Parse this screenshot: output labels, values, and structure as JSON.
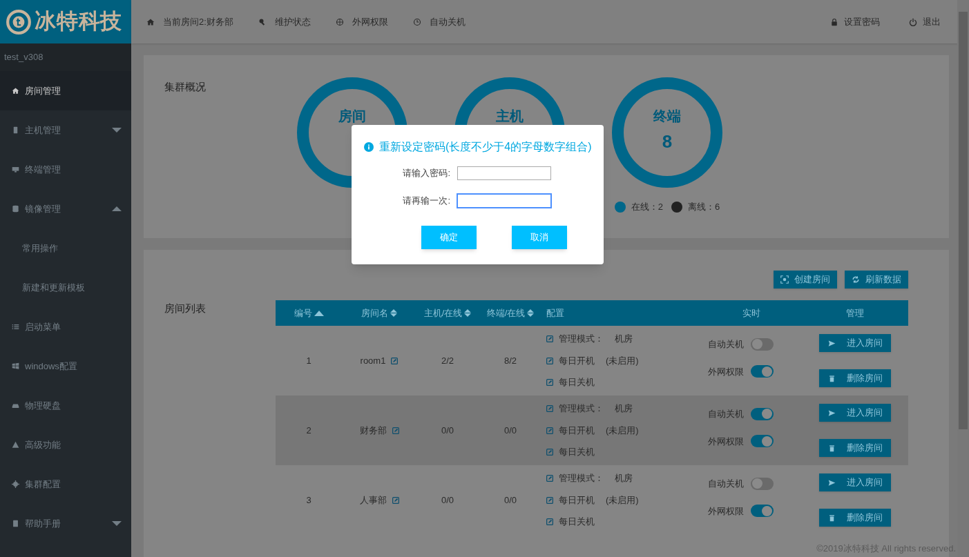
{
  "logo": {
    "text": "冰特科技"
  },
  "topnav": [
    {
      "label": "当前房间2:财务部"
    },
    {
      "label": "维护状态"
    },
    {
      "label": "外网权限"
    },
    {
      "label": "自动关机"
    }
  ],
  "topnav_right": [
    {
      "label": "设置密码"
    },
    {
      "label": "退出"
    }
  ],
  "version": "test_v308",
  "sidebar": {
    "items": [
      {
        "label": "房间管理",
        "selected": true
      },
      {
        "label": "主机管理",
        "selected": false,
        "expanded": false
      },
      {
        "label": "终端管理",
        "selected": false
      },
      {
        "label": "镜像管理",
        "selected": false,
        "expanded": true,
        "children": [
          {
            "label": "常用操作",
            "selected": false
          },
          {
            "label": "新建和更新模板",
            "selected": false
          }
        ]
      },
      {
        "label": "启动菜单",
        "selected": false
      },
      {
        "label": "windows配置",
        "selected": false
      },
      {
        "label": "物理硬盘",
        "selected": false
      },
      {
        "label": "高级功能",
        "selected": false
      },
      {
        "label": "集群配置",
        "selected": false
      },
      {
        "label": "帮助手册",
        "selected": false,
        "expanded": false
      }
    ]
  },
  "overview": {
    "title": "集群概况",
    "rings": [
      {
        "label": "房间"
      },
      {
        "label": "主机"
      },
      {
        "label": "终端",
        "value": "8"
      }
    ],
    "legend": [
      {
        "label": "在线：2",
        "color": "#00678a"
      },
      {
        "label": "离线：6",
        "color": "#222222"
      }
    ]
  },
  "room_list": {
    "title": "房间列表",
    "buttons": [
      {
        "label": "创建房间"
      },
      {
        "label": "刷新数据"
      }
    ],
    "columns": [
      {
        "label": "编号",
        "kind": "sorted"
      },
      {
        "label": "房间名",
        "kind": "sortable"
      },
      {
        "label": "主机/在线",
        "kind": "sortable"
      },
      {
        "label": "终端/在线",
        "kind": "sortable"
      },
      {
        "label": "配置",
        "kind": "plain"
      },
      {
        "label": "实时",
        "kind": "plain"
      },
      {
        "label": "管理",
        "kind": "plain"
      }
    ],
    "rows": [
      {
        "no": "1",
        "name": "room1",
        "hosts": "2/2",
        "terminals": "8/2",
        "config": [
          {
            "label": "管理模式：",
            "value": "机房"
          },
          {
            "label": "每日开机",
            "value": "(未启用)"
          },
          {
            "label": "每日关机"
          }
        ],
        "toggles": [
          {
            "label": "自动关机",
            "on": false
          },
          {
            "label": "外网权限",
            "on": true
          }
        ],
        "actions": [
          {
            "label": "进入房间"
          },
          {
            "label": "删除房间"
          }
        ],
        "selected": false
      },
      {
        "no": "2",
        "name": "财务部",
        "hosts": "0/0",
        "terminals": "0/0",
        "config": [
          {
            "label": "管理模式：",
            "value": "机房"
          },
          {
            "label": "每日开机",
            "value": "(未启用)"
          },
          {
            "label": "每日关机"
          }
        ],
        "toggles": [
          {
            "label": "自动关机",
            "on": true
          },
          {
            "label": "外网权限",
            "on": true
          }
        ],
        "actions": [
          {
            "label": "进入房间"
          },
          {
            "label": "删除房间"
          }
        ],
        "selected": true
      },
      {
        "no": "3",
        "name": "人事部",
        "hosts": "0/0",
        "terminals": "0/0",
        "config": [
          {
            "label": "管理模式：",
            "value": "机房"
          },
          {
            "label": "每日开机",
            "value": "(未启用)"
          },
          {
            "label": "每日关机"
          }
        ],
        "toggles": [
          {
            "label": "自动关机",
            "on": false
          },
          {
            "label": "外网权限",
            "on": true
          }
        ],
        "actions": [
          {
            "label": "进入房间"
          },
          {
            "label": "删除房间"
          }
        ],
        "selected": false
      }
    ]
  },
  "footer": "©2019冰特科技 All rights reserved.",
  "modal": {
    "title": "重新设定密码(长度不少于4的字母数字组合)",
    "fields": [
      {
        "label": "请输入密码:",
        "focused": false
      },
      {
        "label": "请再输一次:",
        "focused": true
      }
    ],
    "buttons": [
      "确定",
      "取消"
    ]
  }
}
